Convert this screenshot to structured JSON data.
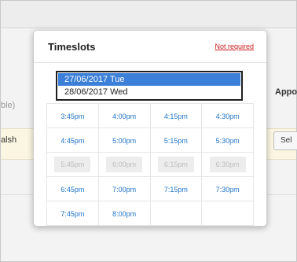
{
  "background": {
    "left_text_1": "ble)",
    "left_text_2": "alsh",
    "right_text": "Appo",
    "right_button": "Sel"
  },
  "popup": {
    "title": "Timeslots",
    "not_required_link": "Not required",
    "dates": [
      {
        "label": "27/06/2017 Tue",
        "selected": true
      },
      {
        "label": "28/06/2017 Wed",
        "selected": false
      }
    ],
    "slot_rows": [
      [
        {
          "time": "3:45pm",
          "enabled": true
        },
        {
          "time": "4:00pm",
          "enabled": true
        },
        {
          "time": "4:15pm",
          "enabled": true
        },
        {
          "time": "4:30pm",
          "enabled": true
        }
      ],
      [
        {
          "time": "4:45pm",
          "enabled": true
        },
        {
          "time": "5:00pm",
          "enabled": true
        },
        {
          "time": "5:15pm",
          "enabled": true
        },
        {
          "time": "5:30pm",
          "enabled": true
        }
      ],
      [
        {
          "time": "5:45pm",
          "enabled": false
        },
        {
          "time": "6:00pm",
          "enabled": false
        },
        {
          "time": "6:15pm",
          "enabled": false
        },
        {
          "time": "6:30pm",
          "enabled": false
        }
      ],
      [
        {
          "time": "6:45pm",
          "enabled": true
        },
        {
          "time": "7:00pm",
          "enabled": true
        },
        {
          "time": "7:15pm",
          "enabled": true
        },
        {
          "time": "7:30pm",
          "enabled": true
        }
      ],
      [
        {
          "time": "7:45pm",
          "enabled": true
        },
        {
          "time": "8:00pm",
          "enabled": true
        }
      ]
    ]
  },
  "colors": {
    "link_blue": "#1f74c9",
    "selected_blue": "#3b7fd9",
    "not_required_red": "#cc1a1a"
  }
}
